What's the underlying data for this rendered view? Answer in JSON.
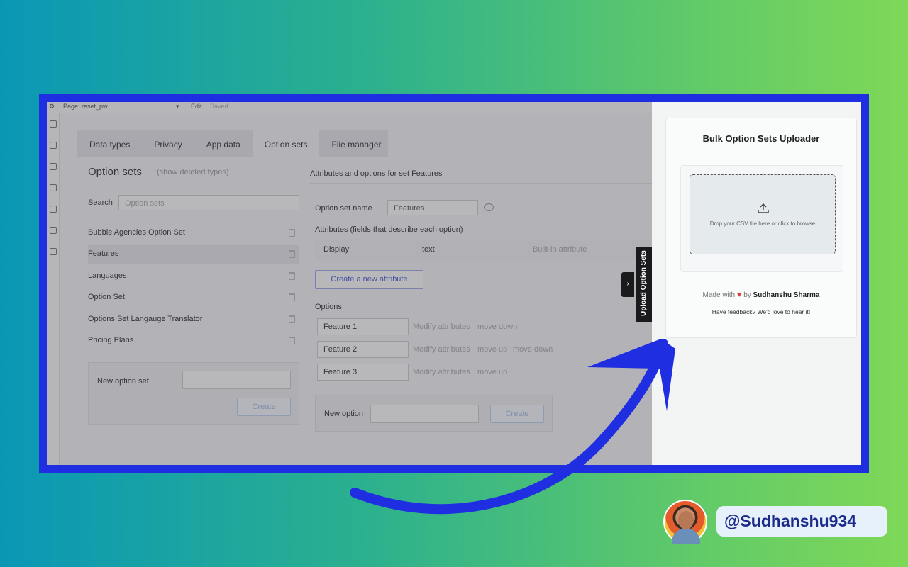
{
  "editor": {
    "topbar": {
      "page_label": "Page: reset_pw",
      "edit": "Edit",
      "saved": "Saved"
    },
    "tabs": [
      "Data types",
      "Privacy",
      "App data",
      "Option sets",
      "File manager"
    ],
    "active_tab": "Option sets",
    "title": "Option sets",
    "show_deleted": "(show deleted types)",
    "search_label": "Search",
    "search_placeholder": "Option sets",
    "option_sets": [
      "Bubble Agencies Option Set",
      "Features",
      "Languages",
      "Option Set",
      "Options Set Langauge Translator",
      "Pricing Plans"
    ],
    "selected_option_set": "Features",
    "new_option_set_label": "New option set",
    "create_label": "Create",
    "attributes_header": "Attributes and options for set Features",
    "option_set_name_label": "Option set name",
    "option_set_name_value": "Features",
    "attributes_label": "Attributes (fields that describe each option)",
    "attribute": {
      "name": "Display",
      "type": "text",
      "note": "Built-in attribute"
    },
    "create_attribute_label": "Create a new attribute",
    "options_label": "Options",
    "options": [
      {
        "name": "Feature 1",
        "actions": [
          "Modify attributes",
          "move down"
        ]
      },
      {
        "name": "Feature 2",
        "actions": [
          "Modify attributes",
          "move up",
          "move down"
        ]
      },
      {
        "name": "Feature 3",
        "actions": [
          "Modify attributes",
          "move up"
        ]
      }
    ],
    "new_option_label": "New option",
    "create_option_label": "Create"
  },
  "sidetab": {
    "label": "Upload Option Sets",
    "chevron": "›"
  },
  "uploader": {
    "title": "Bulk Option Sets Uploader",
    "drop_text": "Drop your CSV file here or click to browse",
    "made_with": "Made with",
    "by": "by",
    "author": "Sudhanshu Sharma",
    "feedback": "Have feedback? We'd love to hear it!"
  },
  "social": {
    "handle": "@Sudhanshu934"
  },
  "colors": {
    "frame": "#1e2ee0",
    "arrow": "#1e2ee0",
    "heart": "#e0393e"
  }
}
